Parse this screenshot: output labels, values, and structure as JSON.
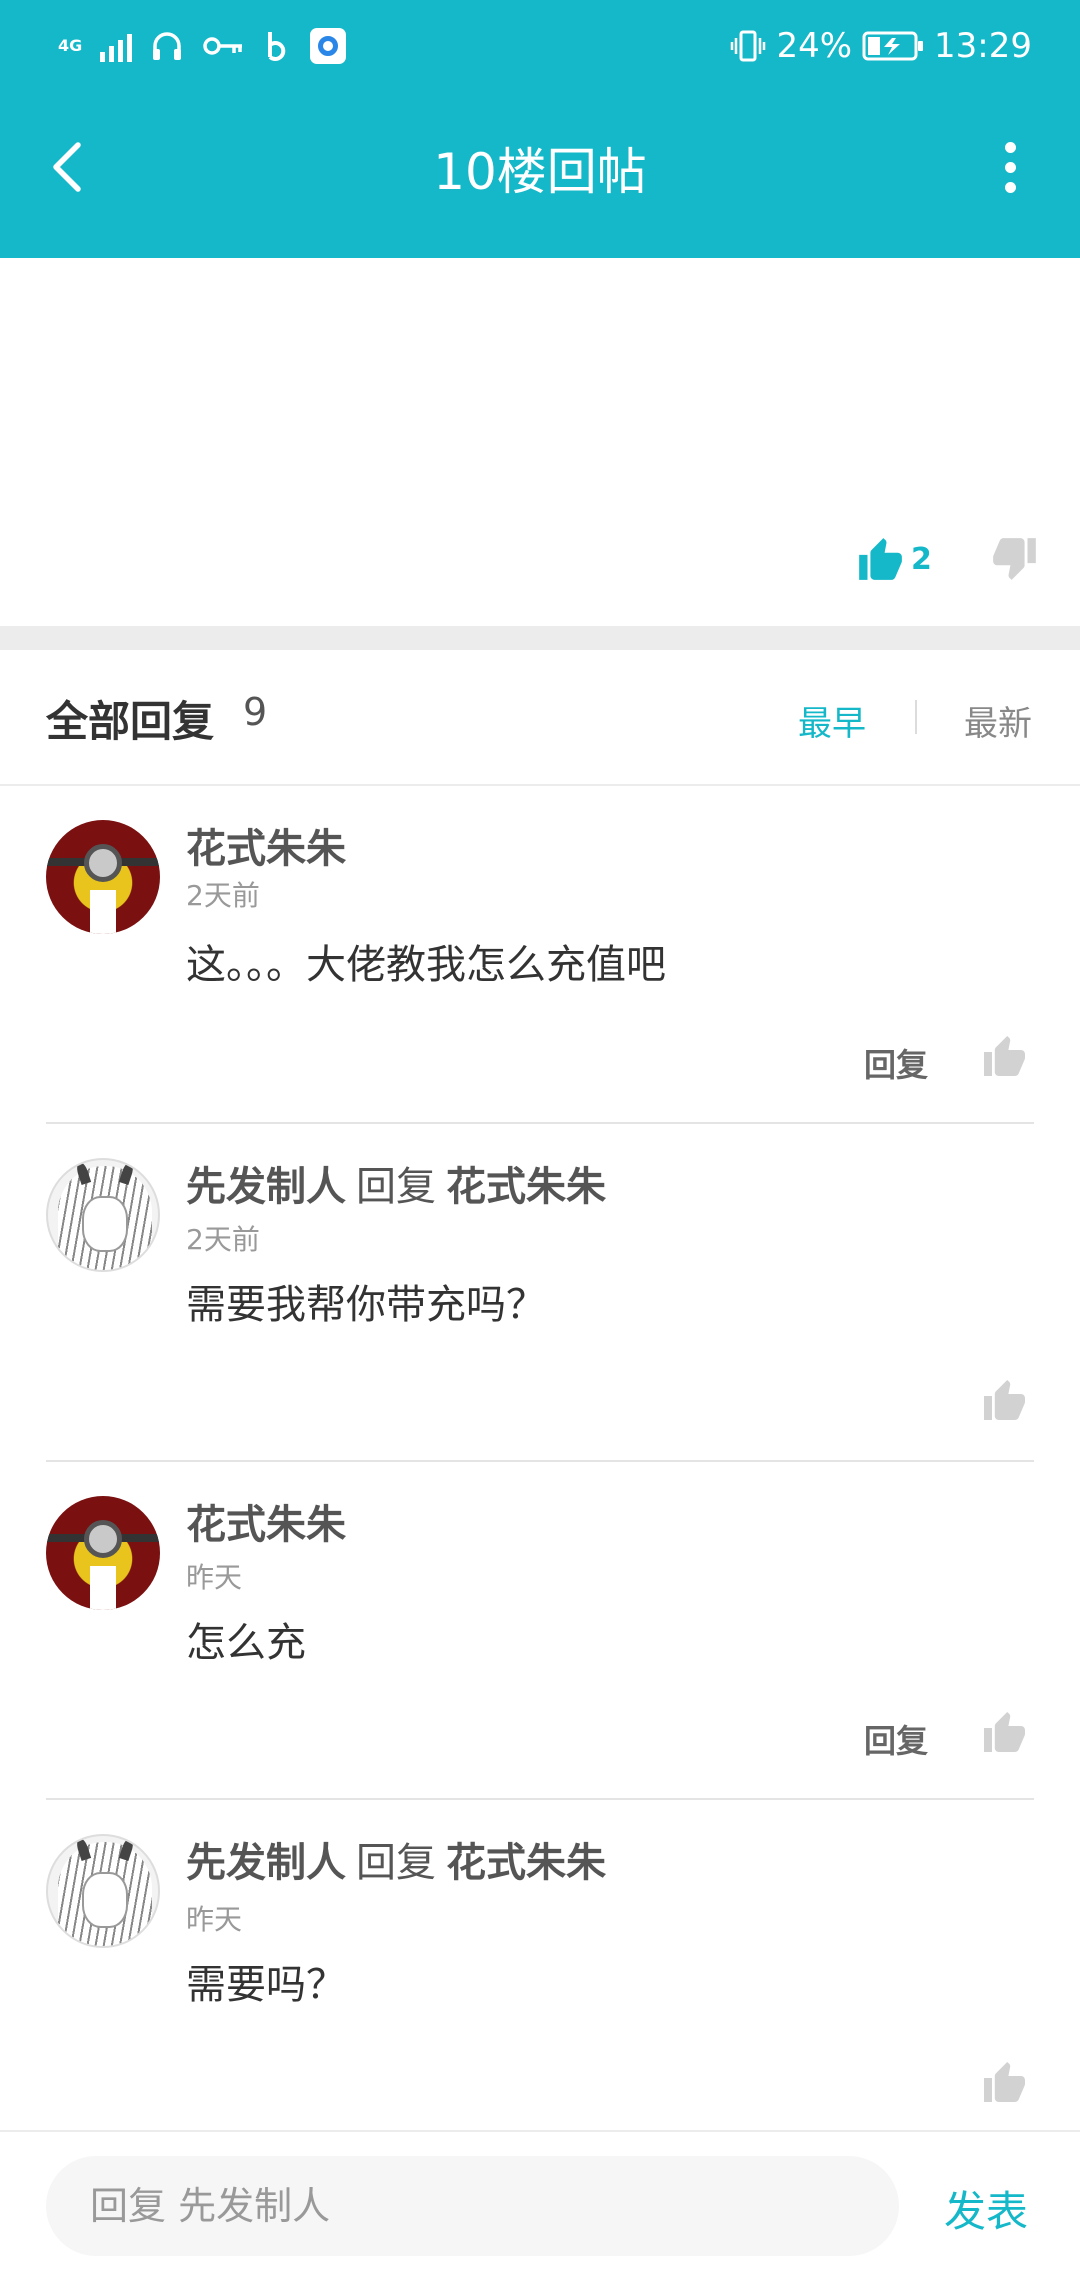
{
  "status_bar": {
    "network": "4G",
    "battery_percent": "24%",
    "time": "13:29"
  },
  "header": {
    "title": "10楼回帖"
  },
  "post": {
    "like_count": "2"
  },
  "replies": {
    "title": "全部回复",
    "count": "9",
    "sort_earliest": "最早",
    "sort_latest": "最新"
  },
  "comments": [
    {
      "author": "花式朱朱",
      "reply_word": "",
      "reply_to": "",
      "time": "2天前",
      "text": "这。。。大佬教我怎么充值吧",
      "reply_label": "回复",
      "avatar": "minion-avatar"
    },
    {
      "author": "先发制人",
      "reply_word": "回复",
      "reply_to": "花式朱朱",
      "time": "2天前",
      "text": "需要我帮你带充吗？",
      "reply_label": "",
      "avatar": "anime-girl-avatar"
    },
    {
      "author": "花式朱朱",
      "reply_word": "",
      "reply_to": "",
      "time": "昨天",
      "text": "怎么充",
      "reply_label": "回复",
      "avatar": "minion-avatar"
    },
    {
      "author": "先发制人",
      "reply_word": "回复",
      "reply_to": "花式朱朱",
      "time": "昨天",
      "text": "需要吗？",
      "reply_label": "",
      "avatar": "anime-girl-avatar"
    }
  ],
  "composer": {
    "placeholder": "回复 先发制人",
    "send_label": "发表"
  },
  "colors": {
    "accent": "#14b8c8",
    "inactive_icon": "#d2d2d2"
  }
}
